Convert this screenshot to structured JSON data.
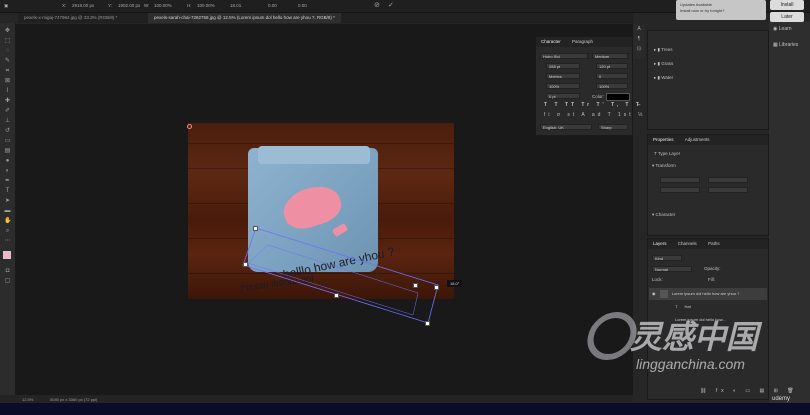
{
  "options_bar": {
    "x": "2918.00 px",
    "y": "1902.00 px",
    "w": "100.00%",
    "h": "100.00%",
    "angle": "18.01",
    "h_skew": "0.00",
    "v_skew": "0.00"
  },
  "tabs": [
    "pexels-x-migaj-747964.jpg @ 33.3% (RGB/8) *",
    "pexels-sarah-chai-7262758.jpg @ 12.5% (Lorem ipsum dol hello how are yhou ?, RGB/8) *"
  ],
  "notification": {
    "title": "Updates Available",
    "body": "Install now or try tonight?",
    "install": "Install",
    "later": "Later"
  },
  "right_nav": {
    "learn": "Learn",
    "libraries": "Libraries"
  },
  "canvas": {
    "warp_text_top": "helllo how are yhou ?",
    "warp_text_bottom": "Lorem ipsum dol",
    "angle_tag": "18.0°"
  },
  "character_panel": {
    "tabs": [
      "Character",
      "Paragraph"
    ],
    "font_family": "Hobo Std",
    "font_style": "Medium",
    "font_size": "288 pt",
    "leading": "120 pt",
    "kerning": "Metrics",
    "tracking": "0",
    "v_scale": "100%",
    "h_scale": "100%",
    "baseline": "0 pt",
    "color_label": "Color:",
    "language": "English: UK",
    "antialias": "Sharp"
  },
  "layers_top": [
    "Trees",
    "Grass",
    "Water"
  ],
  "properties_panel": {
    "tabs": [
      "Properties",
      "Adjustments"
    ],
    "kind": "Type Layer",
    "transform": "Transform",
    "character": "Character"
  },
  "layers_panel": {
    "tabs": [
      "Layers",
      "Channels",
      "Paths"
    ],
    "search": "Kind",
    "normal": "Normal",
    "opacity": "Opacity:",
    "lock": "Lock:",
    "fill": "Fill:",
    "rows": [
      "Lorem ipsum dol hello how are yhou ?",
      "Hat",
      "Lorem ipsum dol hello how..."
    ]
  },
  "status": {
    "zoom": "12.5%",
    "size": "5040 px x 3360 px (72 ppi)"
  },
  "watermark": {
    "brand": "udemy",
    "site": "lingganchina.com",
    "cn": "灵感中国"
  }
}
